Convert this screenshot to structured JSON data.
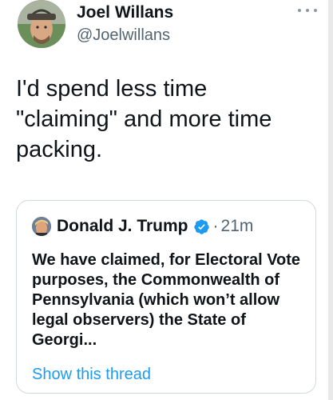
{
  "tweet": {
    "author": {
      "name": "Joel Willans",
      "handle": "@Joelwillans"
    },
    "text": "I'd spend less time \"claiming\" and more time packing."
  },
  "quoted_tweet": {
    "author_name": "Donald J. Trump",
    "separator": "·",
    "time": "21m",
    "text": "We have claimed, for Electoral Vote purposes, the Commonwealth of Pennsylvania (which won’t allow legal observers) the State of Georgi...",
    "show_thread_label": "Show this thread"
  },
  "colors": {
    "text_primary": "#0f1419",
    "text_secondary": "#536471",
    "link": "#1d9bf0",
    "verified": "#1d9bf0",
    "border": "#cfd9de"
  },
  "icons": {
    "more": "more-dots-icon",
    "verified": "verified-badge-icon"
  }
}
